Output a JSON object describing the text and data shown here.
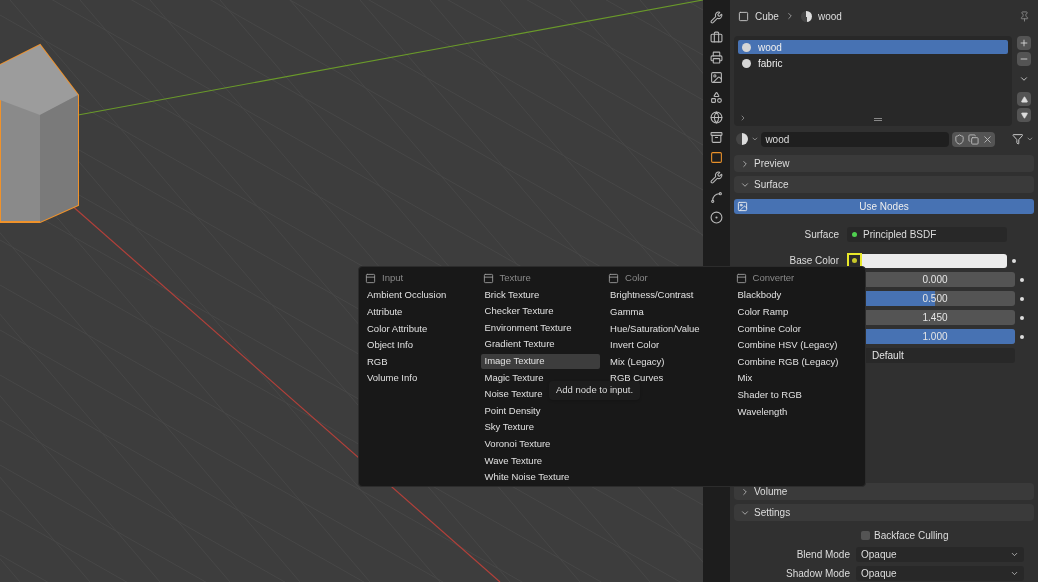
{
  "header": {
    "object": "Cube",
    "material": "wood"
  },
  "material_slots": [
    {
      "name": "wood",
      "selected": true
    },
    {
      "name": "fabric",
      "selected": false
    }
  ],
  "material_field": {
    "value": "wood"
  },
  "panels_top": [
    {
      "title": "Preview",
      "expanded": false
    },
    {
      "title": "Surface",
      "expanded": true
    }
  ],
  "use_nodes": {
    "label": "Use Nodes",
    "on": true
  },
  "surface": {
    "label": "Surface",
    "value": "Principled BSDF"
  },
  "base_color": {
    "label": "Base Color"
  },
  "value_rows": [
    {
      "kind": "factor",
      "reading": "0.000",
      "level": 0
    },
    {
      "kind": "factor",
      "reading": "0.500",
      "level": 0.5
    },
    {
      "kind": "number",
      "reading": "1.450"
    },
    {
      "kind": "factor",
      "reading": "1.000",
      "level": 1
    },
    {
      "kind": "menu",
      "reading": "Default"
    }
  ],
  "panels_bottom": [
    {
      "title": "Volume",
      "expanded": false
    },
    {
      "title": "Settings",
      "expanded": true
    }
  ],
  "settings": {
    "backface_culling": {
      "label": "Backface Culling",
      "checked": false
    },
    "selects": [
      {
        "label": "Blend Mode",
        "value": "Opaque"
      },
      {
        "label": "Shadow Mode",
        "value": "Opaque"
      }
    ]
  },
  "menu": {
    "columns": [
      {
        "title": "Input",
        "items": [
          {
            "label": "Ambient Occlusion",
            "selected": false
          },
          {
            "label": "Attribute",
            "selected": false
          },
          {
            "label": "Color Attribute",
            "selected": false
          },
          {
            "label": "Object Info",
            "selected": false
          },
          {
            "label": "RGB",
            "selected": false
          },
          {
            "label": "Volume Info",
            "selected": false
          }
        ]
      },
      {
        "title": "Texture",
        "items": [
          {
            "label": "Brick Texture",
            "selected": false
          },
          {
            "label": "Checker Texture",
            "selected": false
          },
          {
            "label": "Environment Texture",
            "selected": false
          },
          {
            "label": "Gradient Texture",
            "selected": false
          },
          {
            "label": "Image Texture",
            "selected": true
          },
          {
            "label": "Magic Texture",
            "selected": false
          },
          {
            "label": "Noise Texture",
            "selected": false
          },
          {
            "label": "Point Density",
            "selected": false
          },
          {
            "label": "Sky Texture",
            "selected": false
          },
          {
            "label": "Voronoi Texture",
            "selected": false
          },
          {
            "label": "Wave Texture",
            "selected": false
          },
          {
            "label": "White Noise Texture",
            "selected": false
          }
        ]
      },
      {
        "title": "Color",
        "items": [
          {
            "label": "Brightness/Contrast",
            "selected": false
          },
          {
            "label": "Gamma",
            "selected": false
          },
          {
            "label": "Hue/Saturation/Value",
            "selected": false
          },
          {
            "label": "Invert Color",
            "selected": false
          },
          {
            "label": "Mix (Legacy)",
            "selected": false
          },
          {
            "label": "RGB Curves",
            "selected": false
          }
        ]
      },
      {
        "title": "Converter",
        "items": [
          {
            "label": "Blackbody",
            "selected": false
          },
          {
            "label": "Color Ramp",
            "selected": false
          },
          {
            "label": "Combine Color",
            "selected": false
          },
          {
            "label": "Combine HSV (Legacy)",
            "selected": false
          },
          {
            "label": "Combine RGB (Legacy)",
            "selected": false
          },
          {
            "label": "Mix",
            "selected": false
          },
          {
            "label": "Shader to RGB",
            "selected": false
          },
          {
            "label": "Wavelength",
            "selected": false
          }
        ]
      }
    ]
  },
  "tooltip": "Add node to input."
}
